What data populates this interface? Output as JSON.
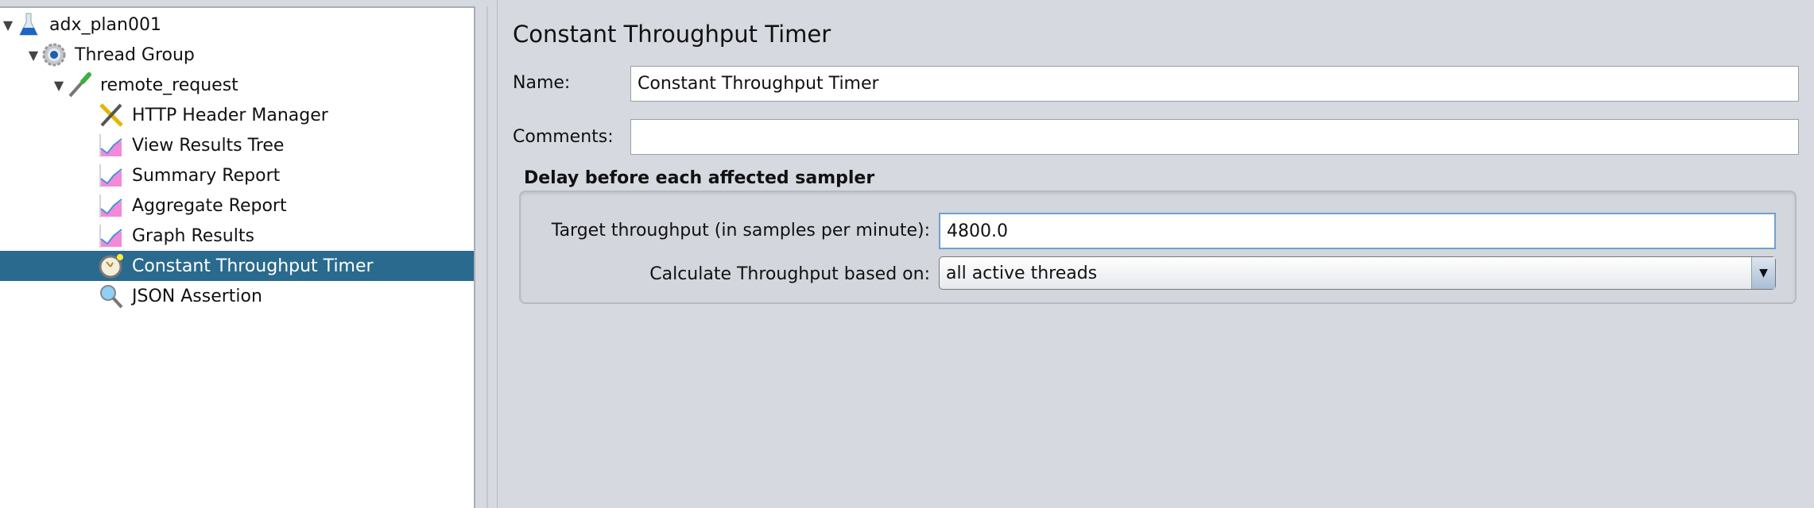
{
  "tree": {
    "items": [
      {
        "label": "adx_plan001",
        "icon": "test-plan-flask-icon",
        "expanded": true,
        "level": 0
      },
      {
        "label": "Thread Group",
        "icon": "gear-icon",
        "expanded": true,
        "level": 1
      },
      {
        "label": "remote_request",
        "icon": "sampler-pipette-icon",
        "expanded": true,
        "level": 2
      },
      {
        "label": "HTTP Header Manager",
        "icon": "wrench-screwdriver-icon",
        "level": 3
      },
      {
        "label": "View Results Tree",
        "icon": "chart-listener-icon",
        "level": 3
      },
      {
        "label": "Summary Report",
        "icon": "chart-listener-icon",
        "level": 3
      },
      {
        "label": "Aggregate Report",
        "icon": "chart-listener-icon",
        "level": 3
      },
      {
        "label": "Graph Results",
        "icon": "chart-listener-icon",
        "level": 3
      },
      {
        "label": "Constant Throughput Timer",
        "icon": "timer-clock-icon",
        "level": 3,
        "selected": true
      },
      {
        "label": "JSON Assertion",
        "icon": "magnifier-icon",
        "level": 3
      }
    ]
  },
  "panel": {
    "title": "Constant Throughput Timer",
    "name_label": "Name:",
    "name_value": "Constant Throughput Timer",
    "comments_label": "Comments:",
    "comments_value": "",
    "group_title": "Delay before each affected sampler",
    "target_label": "Target throughput (in samples per minute):",
    "target_value": "4800.0",
    "calc_label": "Calculate Throughput based on:",
    "calc_value": "all active threads"
  },
  "colors": {
    "selection": "#2a6a8e",
    "background": "#d6d9df",
    "focus": "#6fa0d0"
  }
}
